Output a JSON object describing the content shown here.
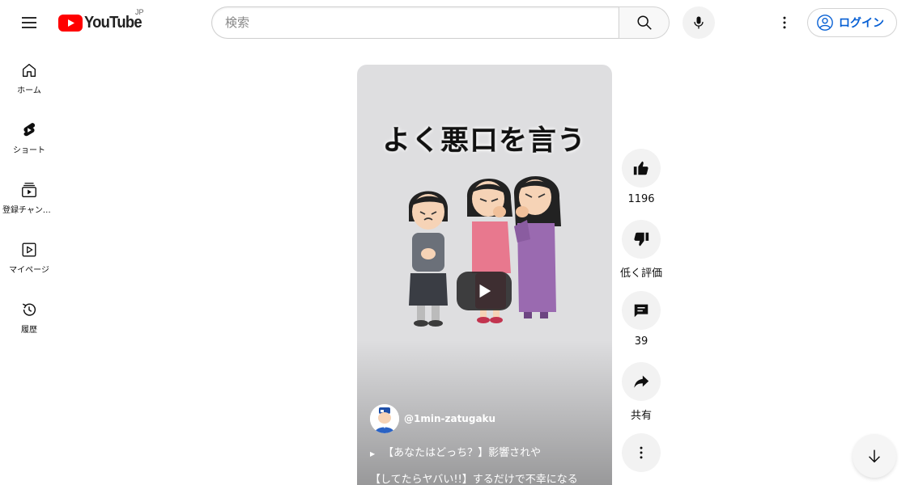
{
  "header": {
    "logo_text": "YouTube",
    "region": "JP",
    "search_placeholder": "検索",
    "login_label": "ログイン"
  },
  "sidebar": {
    "items": [
      {
        "label": "ホーム",
        "icon": "home-icon"
      },
      {
        "label": "ショート",
        "icon": "shorts-icon"
      },
      {
        "label": "登録チャンネル",
        "icon": "subscriptions-icon"
      },
      {
        "label": "マイページ",
        "icon": "you-icon"
      },
      {
        "label": "履歴",
        "icon": "history-icon"
      }
    ]
  },
  "video": {
    "overlay_title": "よく悪口を言う",
    "channel": "@1min-zatugaku",
    "description_line1": "【あなたはどっち？】影響されや",
    "description_line2": "【してたらヤバい!!】するだけで不幸になる"
  },
  "actions": {
    "like_count": "1196",
    "dislike_label": "低く評価",
    "comment_count": "39",
    "share_label": "共有"
  },
  "colors": {
    "brand_red": "#ff0000",
    "link_blue": "#065fd4"
  }
}
